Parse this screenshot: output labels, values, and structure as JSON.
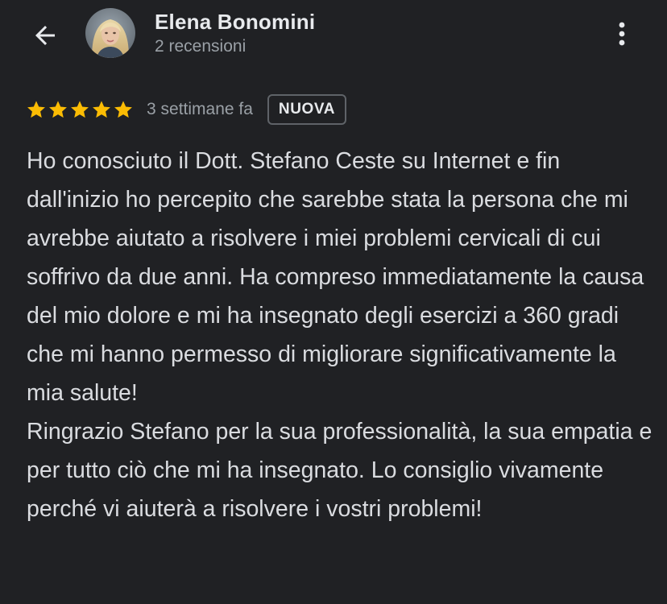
{
  "header": {
    "reviewer_name": "Elena Bonomini",
    "reviewer_subtitle": "2 recensioni",
    "back_icon": "arrow-back-icon",
    "more_icon": "more-vertical-icon"
  },
  "review": {
    "rating": 5,
    "rating_max": 5,
    "time_ago": "3 settimane fa",
    "badge": "NUOVA",
    "paragraphs": [
      "Ho conosciuto il Dott. Stefano Ceste su Internet e fin dall'inizio ho percepito che sarebbe stata la persona che mi avrebbe aiutato a risolvere i miei problemi cervicali di cui soffrivo da due anni. Ha compreso immediatamente la causa del mio dolore e mi ha insegnato degli esercizi a 360 gradi che mi hanno permesso di migliorare significativamente la mia salute!",
      "Ringrazio Stefano per la sua professionalità, la sua empatia e per tutto ciò che mi ha insegnato. Lo consiglio vivamente perché vi aiuterà a risolvere i vostri problemi!"
    ]
  },
  "colors": {
    "background": "#202124",
    "star": "#fbbc04",
    "text_primary": "#e8eaed",
    "text_secondary": "#9aa0a6"
  }
}
